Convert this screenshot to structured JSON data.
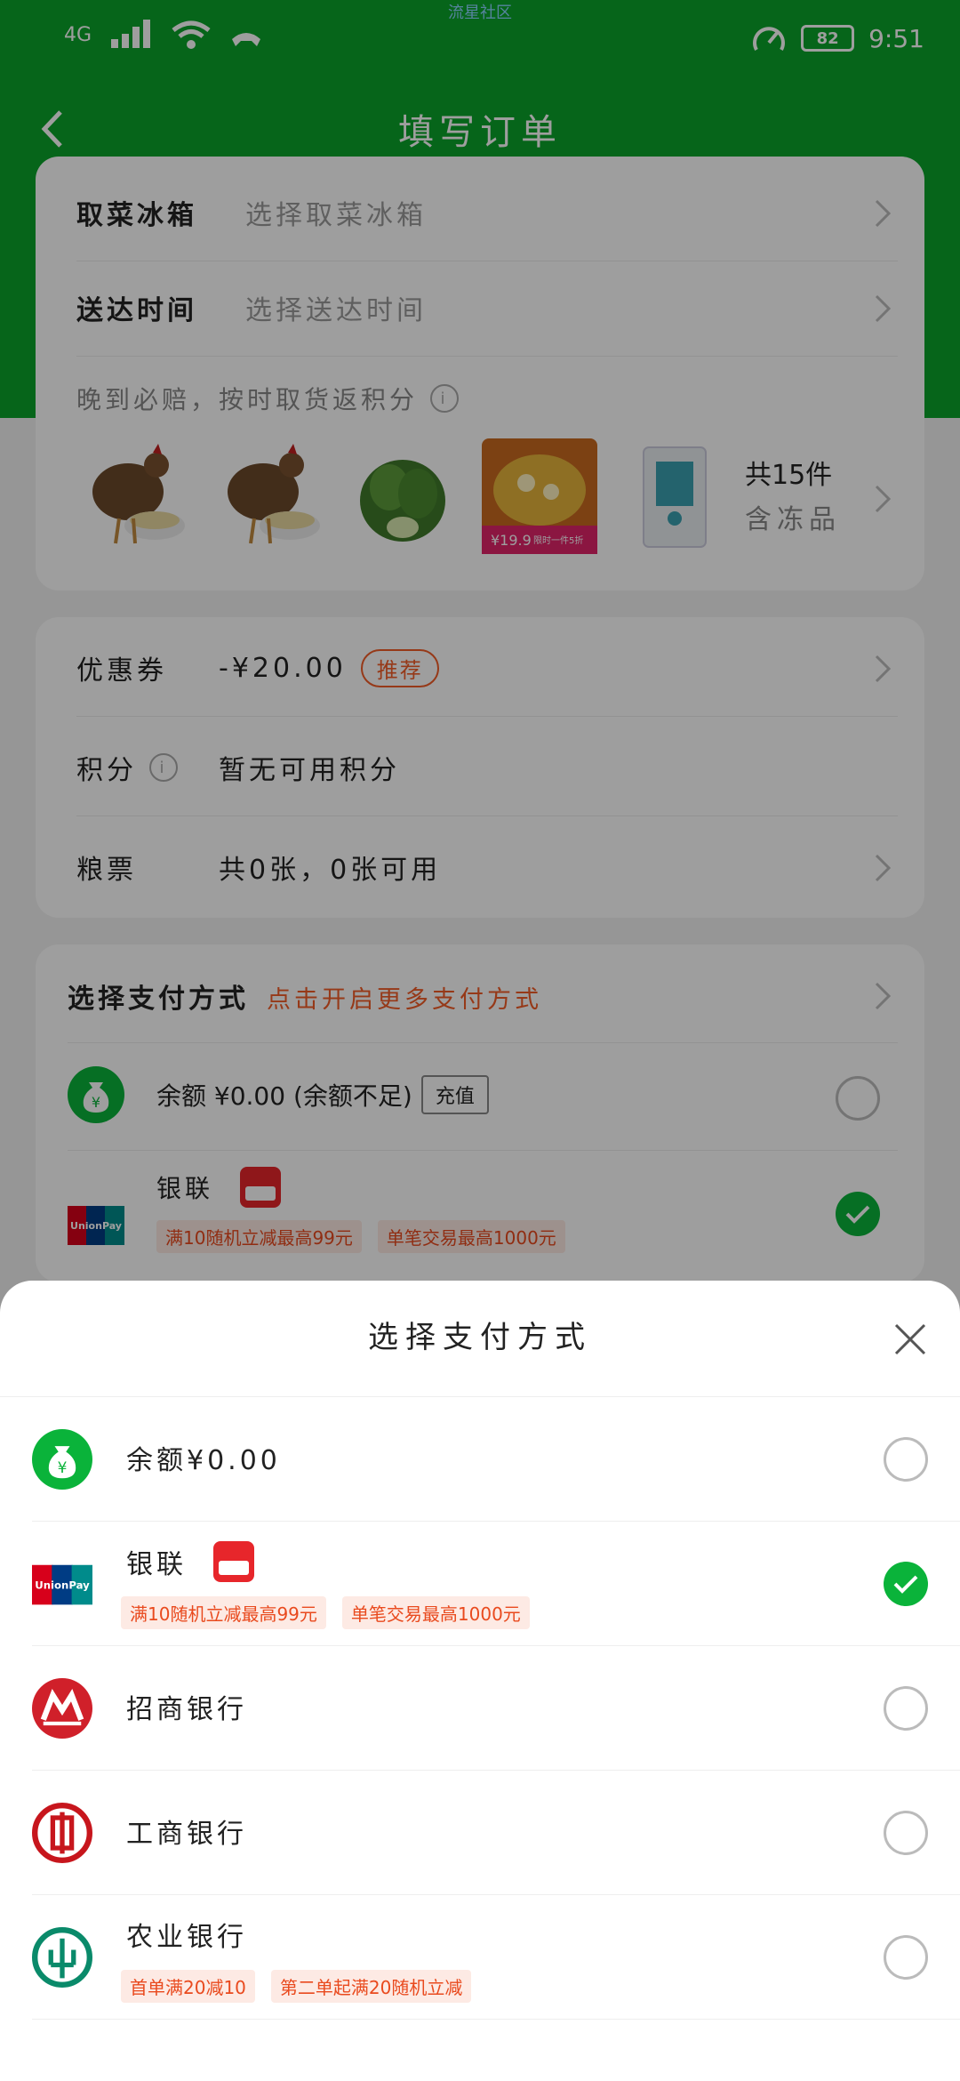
{
  "status_bar": {
    "network": "4G",
    "center_text": "流星社区",
    "battery": "82",
    "time": "9:51"
  },
  "nav": {
    "title": "填写订单"
  },
  "delivery": {
    "fridge_label": "取菜冰箱",
    "fridge_value": "选择取菜冰箱",
    "time_label": "送达时间",
    "time_value": "选择送达时间",
    "hint": "晚到必赔，按时取货返积分",
    "count_text": "共15件",
    "frozen_text": "含冻品",
    "thumb_badge_price": "¥19.9",
    "thumb_badge_text": "限时一件5折"
  },
  "discount": {
    "coupon_label": "优惠券",
    "coupon_value": "-¥20.00",
    "coupon_tag": "推荐",
    "points_label": "积分",
    "points_value": "暂无可用积分",
    "ticket_label": "粮票",
    "ticket_value": "共0张，0张可用"
  },
  "payment_card": {
    "title": "选择支付方式",
    "more": "点击开启更多支付方式",
    "balance_text": "余额 ¥0.00 (余额不足)",
    "recharge": "充值",
    "unionpay_label": "银联",
    "promos": [
      "满10随机立减最高99元",
      "单笔交易最高1000元"
    ]
  },
  "sheet": {
    "title": "选择支付方式",
    "options": [
      {
        "label": "余额¥0.00",
        "promos": []
      },
      {
        "label": "银联",
        "promos": [
          "满10随机立减最高99元",
          "单笔交易最高1000元"
        ]
      },
      {
        "label": "招商银行",
        "promos": []
      },
      {
        "label": "工商银行",
        "promos": []
      },
      {
        "label": "农业银行",
        "promos": [
          "首单满20减10",
          "第二单起满20随机立减"
        ]
      }
    ]
  },
  "colors": {
    "brand_green": "#0aa32a",
    "accent_red": "#f25c27",
    "check_green": "#0ab33a"
  }
}
